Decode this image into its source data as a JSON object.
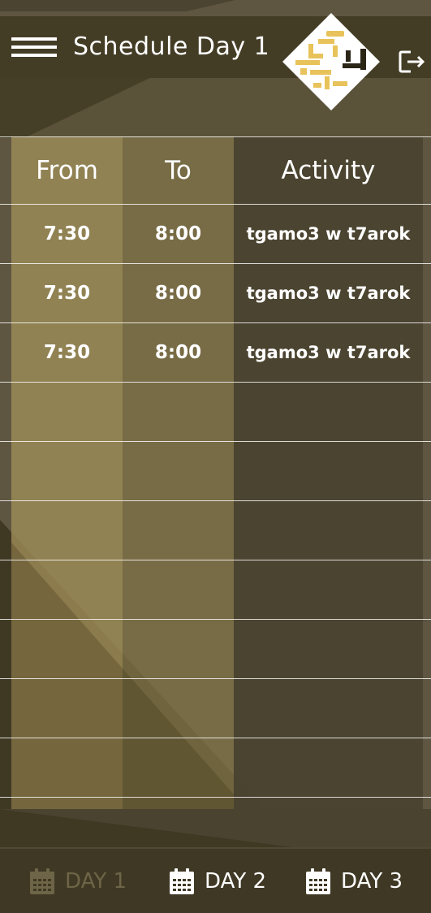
{
  "header": {
    "title": "Schedule Day 1",
    "menu_icon": "hamburger-menu-icon",
    "exit_icon": "sign-out-icon"
  },
  "table": {
    "columns": [
      "From",
      "To",
      "Activity"
    ],
    "rows": [
      {
        "from": "7:30",
        "to": "8:00",
        "activity": "tgamo3 w t7arok"
      },
      {
        "from": "7:30",
        "to": "8:00",
        "activity": "tgamo3 w t7arok"
      },
      {
        "from": "7:30",
        "to": "8:00",
        "activity": "tgamo3 w t7arok"
      },
      {
        "from": "",
        "to": "",
        "activity": ""
      },
      {
        "from": "",
        "to": "",
        "activity": ""
      },
      {
        "from": "",
        "to": "",
        "activity": ""
      },
      {
        "from": "",
        "to": "",
        "activity": ""
      },
      {
        "from": "",
        "to": "",
        "activity": ""
      },
      {
        "from": "",
        "to": "",
        "activity": ""
      },
      {
        "from": "",
        "to": "",
        "activity": ""
      }
    ]
  },
  "bottom_nav": {
    "tabs": [
      {
        "label": "DAY 1",
        "icon": "calendar-icon",
        "active": true
      },
      {
        "label": "DAY 2",
        "icon": "calendar-icon",
        "active": false
      },
      {
        "label": "DAY 3",
        "icon": "calendar-icon",
        "active": false
      }
    ]
  },
  "colors": {
    "background": "#5e5641",
    "header": "#423b24",
    "from_column": "#8f8050",
    "to_column": "#766a45",
    "activity_column": "#4a4330",
    "logo_gold": "#e8c25a",
    "inactive_tab": "#6e6548"
  }
}
